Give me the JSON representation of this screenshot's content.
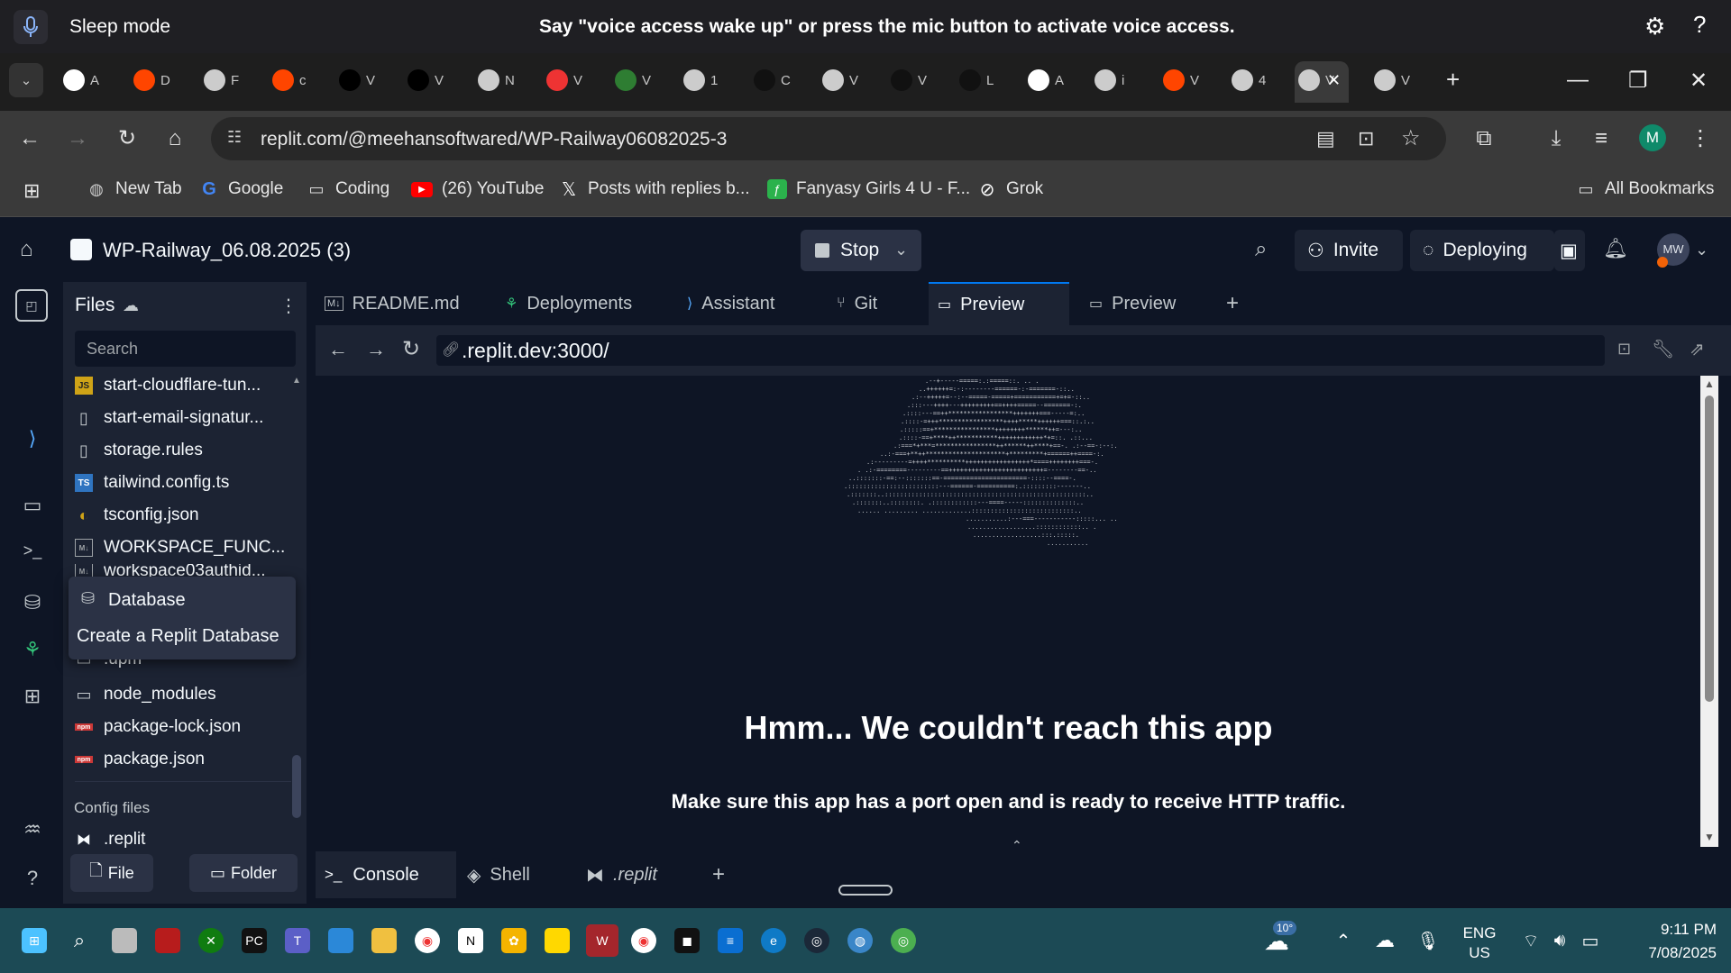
{
  "voice": {
    "status": "Sleep mode",
    "message": "Say \"voice access wake up\" or press the mic button to activate voice access.",
    "help": "?"
  },
  "browser": {
    "tab_letters": [
      "A",
      "D",
      "F",
      "c",
      "V",
      "V",
      "N",
      "V",
      "V",
      "1",
      "C",
      "V",
      "V",
      "L",
      "A",
      "i",
      "V",
      "4",
      "V",
      "V"
    ],
    "active_tab_close": "✕",
    "url": "replit.com/@meehansoftwared/WP-Railway06082025-3",
    "profile_initial": "M",
    "bookmarks": [
      {
        "label": "New Tab",
        "icon": "globe-icon"
      },
      {
        "label": "Google",
        "icon": "google-icon"
      },
      {
        "label": "Coding",
        "icon": "folder-icon"
      },
      {
        "label": "(26) YouTube",
        "icon": "youtube-icon"
      },
      {
        "label": "Posts with replies b...",
        "icon": "x-icon"
      },
      {
        "label": "Fanyasy Girls 4 U - F...",
        "icon": "feedly-icon"
      },
      {
        "label": "Grok",
        "icon": "grok-icon"
      }
    ],
    "all_bookmarks": "All Bookmarks"
  },
  "replit": {
    "project_title": "WP-Railway_06.08.2025 (3)",
    "stop_label": "Stop",
    "invite_label": "Invite",
    "deploying_label": "Deploying",
    "user_initials": "MW",
    "files_title": "Files",
    "search_placeholder": "Search",
    "files": [
      {
        "name": "start-cloudflare-tun...",
        "type": "js"
      },
      {
        "name": "start-email-signatur...",
        "type": "file"
      },
      {
        "name": "storage.rules",
        "type": "file"
      },
      {
        "name": "tailwind.config.ts",
        "type": "ts"
      },
      {
        "name": "tsconfig.json",
        "type": "json"
      },
      {
        "name": "WORKSPACE_FUNC...",
        "type": "md"
      },
      {
        "name": "workspace03authid...",
        "type": "md"
      }
    ],
    "files_below": [
      {
        "name": ".upm",
        "type": "folder"
      },
      {
        "name": "node_modules",
        "type": "folder"
      },
      {
        "name": "package-lock.json",
        "type": "npm"
      },
      {
        "name": "package.json",
        "type": "npm"
      }
    ],
    "config_header": "Config files",
    "config_files": [
      {
        "name": ".replit",
        "type": "replit"
      }
    ],
    "popup_title": "Database",
    "popup_action": "Create a Replit Database",
    "new_file": "File",
    "new_folder": "Folder",
    "editor_tabs": [
      {
        "label": "README.md",
        "icon": "markdown-icon"
      },
      {
        "label": "Deployments",
        "icon": "deploy-icon"
      },
      {
        "label": "Assistant",
        "icon": "assistant-icon"
      },
      {
        "label": "Git",
        "icon": "git-icon"
      },
      {
        "label": "Preview",
        "icon": "preview-icon",
        "active": true
      },
      {
        "label": "Preview",
        "icon": "preview-icon"
      }
    ],
    "preview_url": ".replit.dev:3000/",
    "error_title": "Hmm... We couldn't reach this app",
    "error_message": "Make sure this app has a port open and is ready to receive HTTP traffic.",
    "console_tabs": [
      {
        "label": "Console",
        "active": true
      },
      {
        "label": "Shell"
      },
      {
        "label": ".replit"
      }
    ]
  },
  "taskbar": {
    "weather_temp": "10°",
    "lang_1": "ENG",
    "lang_2": "US",
    "time": "9:11 PM",
    "date": "7/08/2025"
  },
  "colors": {
    "replit_bg": "#0e1525",
    "replit_panel": "#1c2333",
    "accent": "#0079f2",
    "taskbar": "#1c4a55"
  }
}
